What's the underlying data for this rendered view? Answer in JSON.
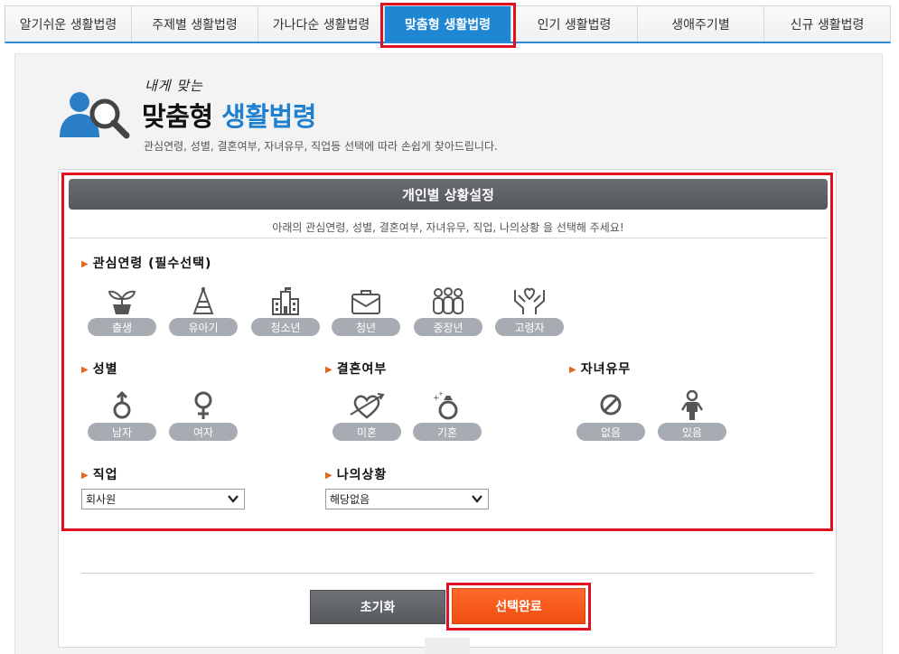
{
  "tabs": [
    {
      "label": "알기쉬운 생활법령",
      "active": false
    },
    {
      "label": "주제별 생활법령",
      "active": false
    },
    {
      "label": "가나다순 생활법령",
      "active": false
    },
    {
      "label": "맞춤형 생활법령",
      "active": true
    },
    {
      "label": "인기 생활법령",
      "active": false
    },
    {
      "label": "생애주기별",
      "active": false
    },
    {
      "label": "신규 생활법령",
      "active": false
    }
  ],
  "header": {
    "script": "내게 맞는",
    "title_main": "맞춤형",
    "title_accent": "생활법령",
    "description": "관심연령, 성별, 결혼여부, 자녀유무, 직업등  선택에 따라 손쉽게 찾아드립니다.",
    "icon": "person-search-icon"
  },
  "panel": {
    "title": "개인별 상황설정",
    "description": "아래의 관심연령, 성별, 결혼여부, 자녀유무, 직업, 나의상황 을 선택해 주세요!"
  },
  "age": {
    "title": "관심연령 (필수선택)",
    "options": [
      {
        "label": "출생",
        "icon": "sprout-icon"
      },
      {
        "label": "유아기",
        "icon": "party-hat-icon"
      },
      {
        "label": "청소년",
        "icon": "school-building-icon"
      },
      {
        "label": "청년",
        "icon": "briefcase-icon"
      },
      {
        "label": "중장년",
        "icon": "family-icon"
      },
      {
        "label": "고령자",
        "icon": "care-hands-icon"
      }
    ]
  },
  "gender": {
    "title": "성별",
    "options": [
      {
        "label": "남자",
        "icon": "male-icon"
      },
      {
        "label": "여자",
        "icon": "female-icon"
      }
    ]
  },
  "marriage": {
    "title": "결혼여부",
    "options": [
      {
        "label": "미혼",
        "icon": "heart-arrow-icon"
      },
      {
        "label": "기혼",
        "icon": "ring-icon"
      }
    ]
  },
  "children": {
    "title": "자녀유무",
    "options": [
      {
        "label": "없음",
        "icon": "prohibited-icon"
      },
      {
        "label": "있음",
        "icon": "child-icon"
      }
    ]
  },
  "job": {
    "title": "직업",
    "selected": "회사원"
  },
  "situation": {
    "title": "나의상황",
    "selected": "해당없음"
  },
  "buttons": {
    "reset": "초기화",
    "done": "선택완료"
  },
  "colors": {
    "accent": "#1f86d3",
    "highlight": "#e0101e",
    "done": "#f25411",
    "pill": "#a7acb2"
  }
}
